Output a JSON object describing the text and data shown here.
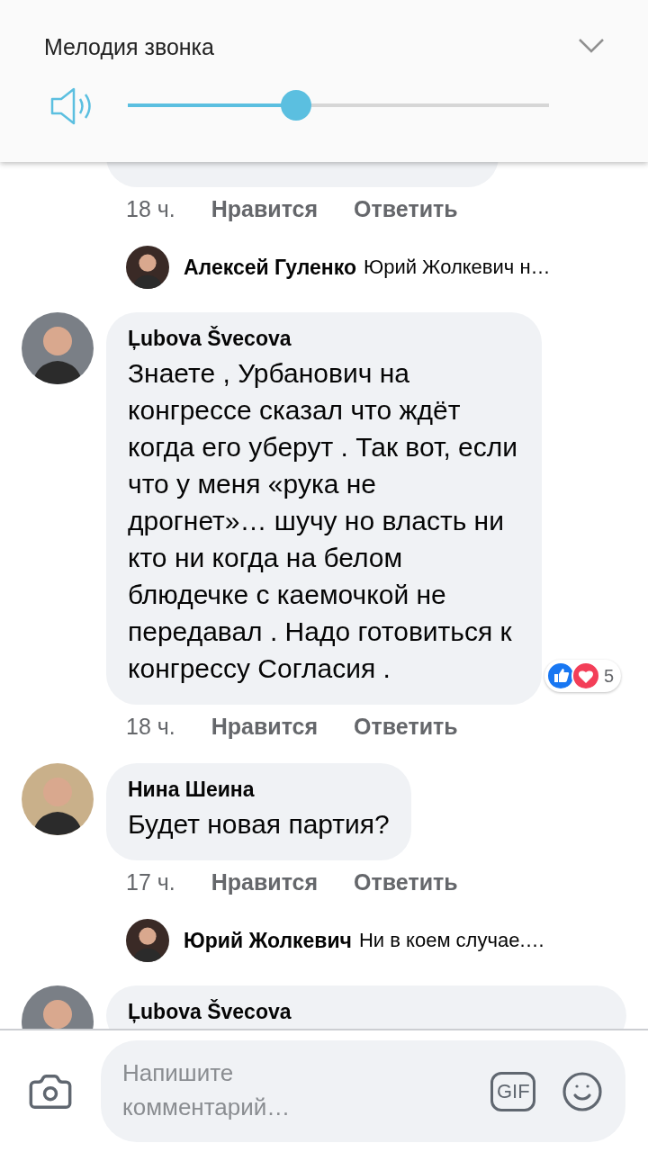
{
  "volume_panel": {
    "title": "Мелодия звонка",
    "level": 0.4
  },
  "comments": [
    {
      "time": "18 ч.",
      "like": "Нравится",
      "reply": "Ответить",
      "replies": [
        {
          "author": "Алексей Гуленко",
          "text": "Юрий Жолкевич н…"
        }
      ]
    },
    {
      "author": "Ļubova Švecova",
      "text": "Знаете , Урбанович на конгрессе сказал что ждёт когда его уберут . Так вот, если что у меня «рука не дрогнет»… шучу но власть ни кто ни когда на белом блюдечке с каемочкой не передавал . Надо готовиться к конгрессу Согласия .",
      "reactions": {
        "count": "5"
      },
      "time": "18 ч.",
      "like": "Нравится",
      "reply": "Ответить"
    },
    {
      "author": "Нина Шеина",
      "text": "Будет новая партия?",
      "time": "17 ч.",
      "like": "Нравится",
      "reply": "Ответить",
      "replies": [
        {
          "author": "Юрий Жолкевич",
          "text": "Ни в коем случае.…"
        }
      ]
    },
    {
      "author": "Ļubova Švecova"
    }
  ],
  "composer": {
    "placeholder": "Напишите комментарий…",
    "gif_label": "GIF"
  }
}
